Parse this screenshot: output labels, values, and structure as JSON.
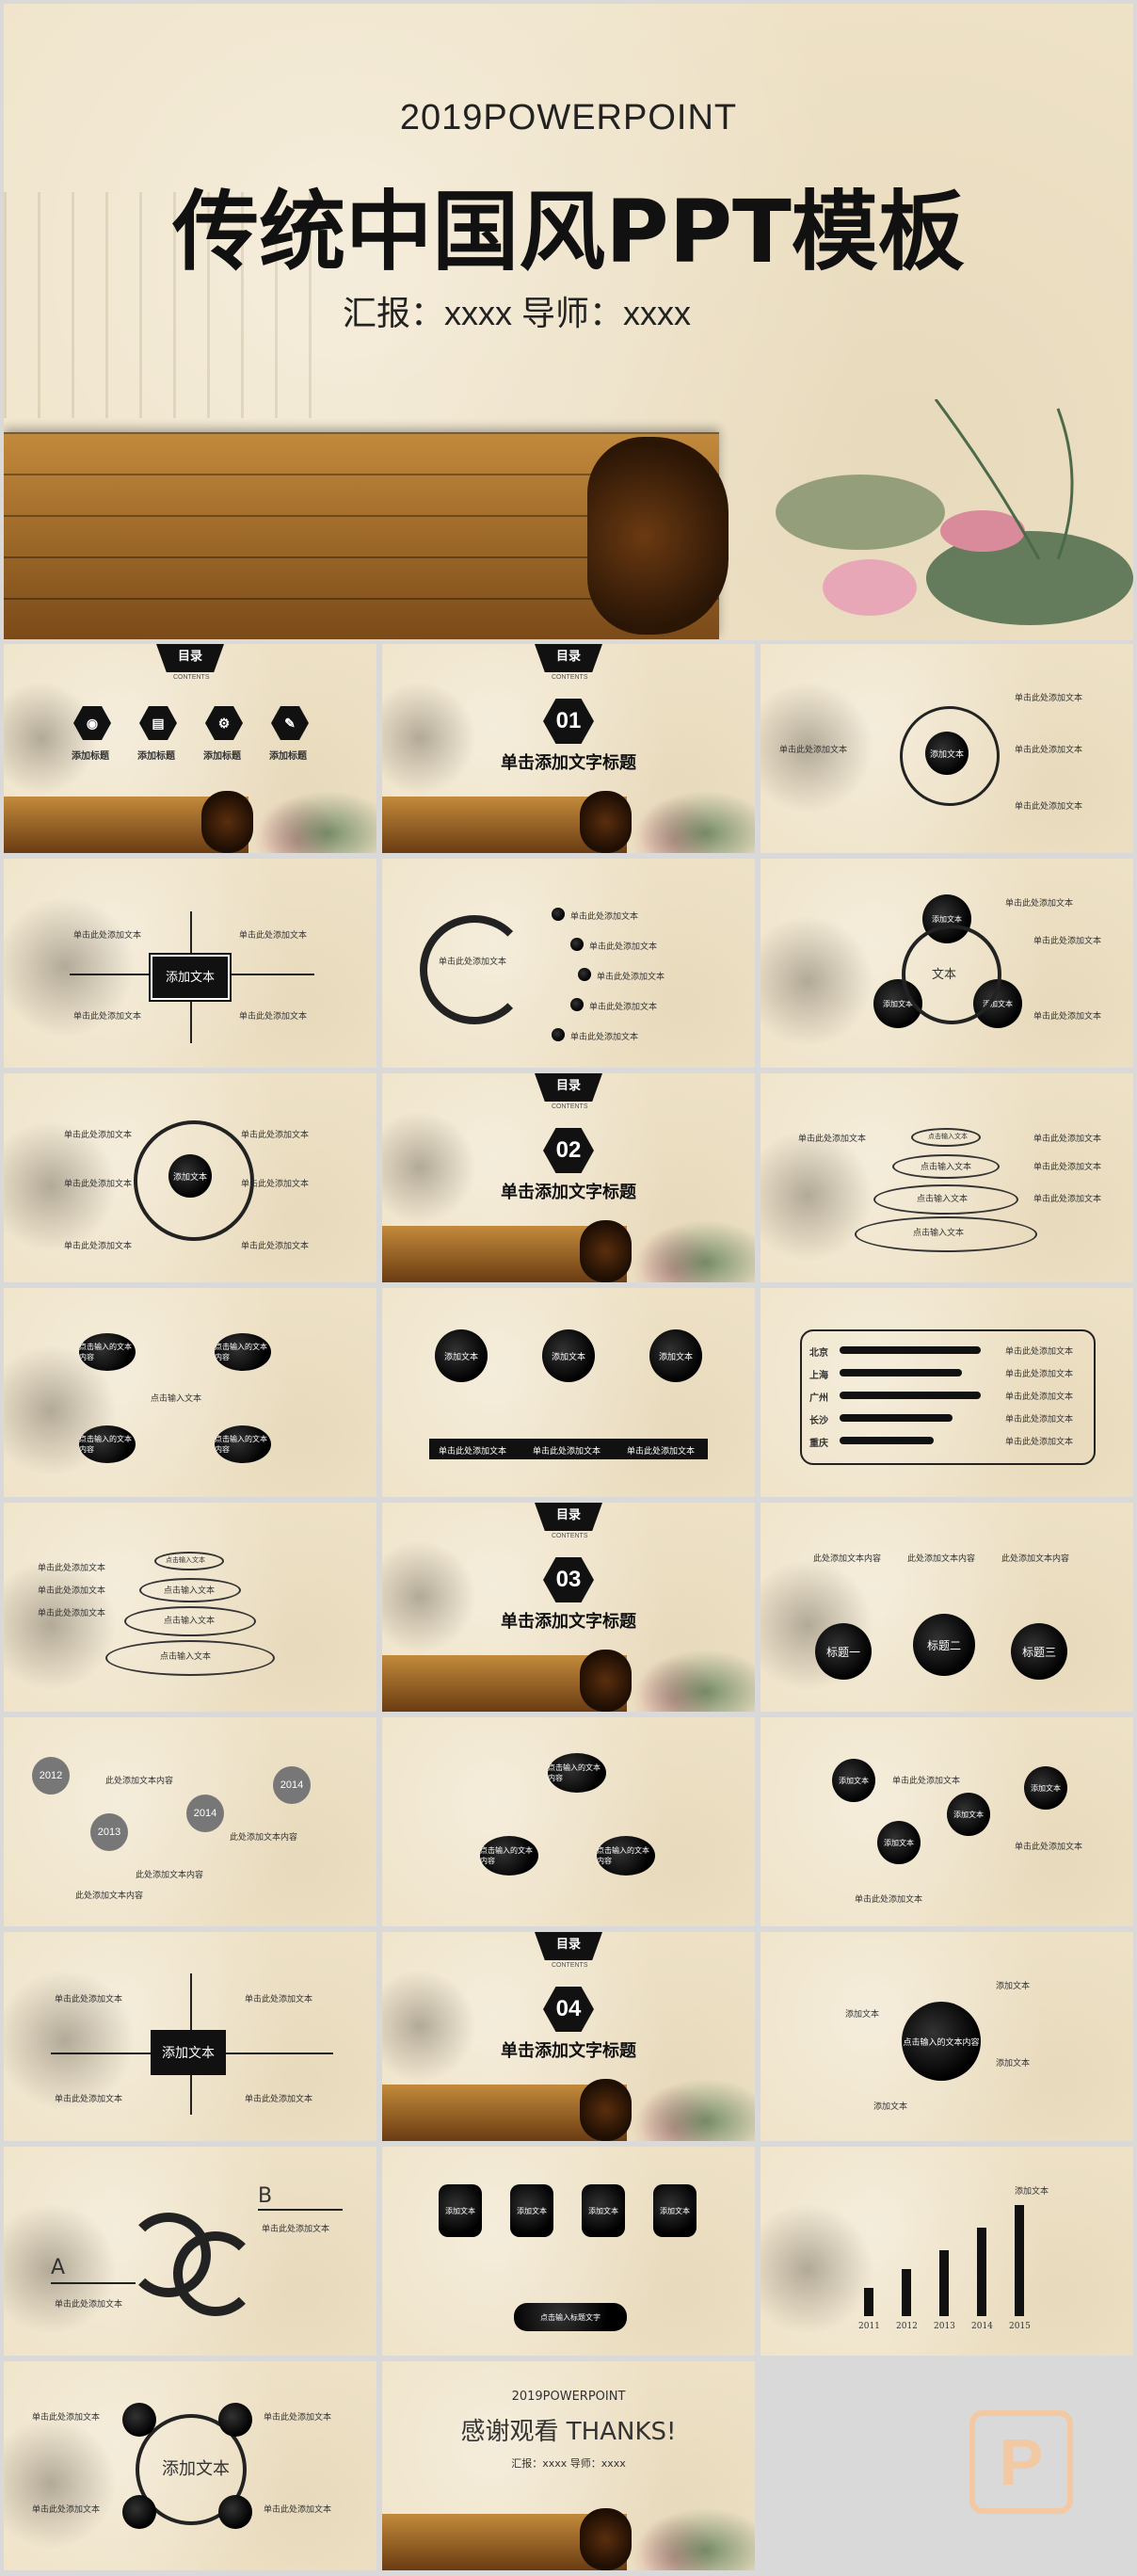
{
  "hero": {
    "subtitle": "2019POWERPOINT",
    "title": "传统中国风PPT模板",
    "meta": "汇报：xxxx  导师：xxxx"
  },
  "toc": {
    "label": "目录",
    "contents": "CONTENTS",
    "items": [
      "添加标题",
      "添加标题",
      "添加标题",
      "添加标题"
    ]
  },
  "sections": [
    {
      "number": "01",
      "title": "单击添加文字标题"
    },
    {
      "number": "02",
      "title": "单击添加文字标题"
    },
    {
      "number": "03",
      "title": "单击添加文字标题"
    },
    {
      "number": "04",
      "title": "单击添加文字标题"
    }
  ],
  "common": {
    "placeholder": "单击此处添加文本",
    "add_text": "添加文本",
    "click_input": "点击输入文本",
    "click_input_2": "点击输入的文本内容",
    "wenben": "文本",
    "add_text_content": "此处添加文本内容",
    "click_input_title": "点击输入标题文字"
  },
  "cities": [
    "北京",
    "上海",
    "广州",
    "长沙",
    "重庆"
  ],
  "titles": [
    "标题一",
    "标题二",
    "标题三"
  ],
  "years": [
    "2012",
    "2013",
    "2014",
    "2014"
  ],
  "years2": [
    "2011",
    "2012",
    "2013",
    "2014",
    "2015"
  ],
  "letters": [
    "A",
    "B"
  ],
  "end": {
    "subtitle": "2019POWERPOINT",
    "title": "感谢观看 THANKS!",
    "meta": "汇报：xxxx  导师：xxxx"
  }
}
